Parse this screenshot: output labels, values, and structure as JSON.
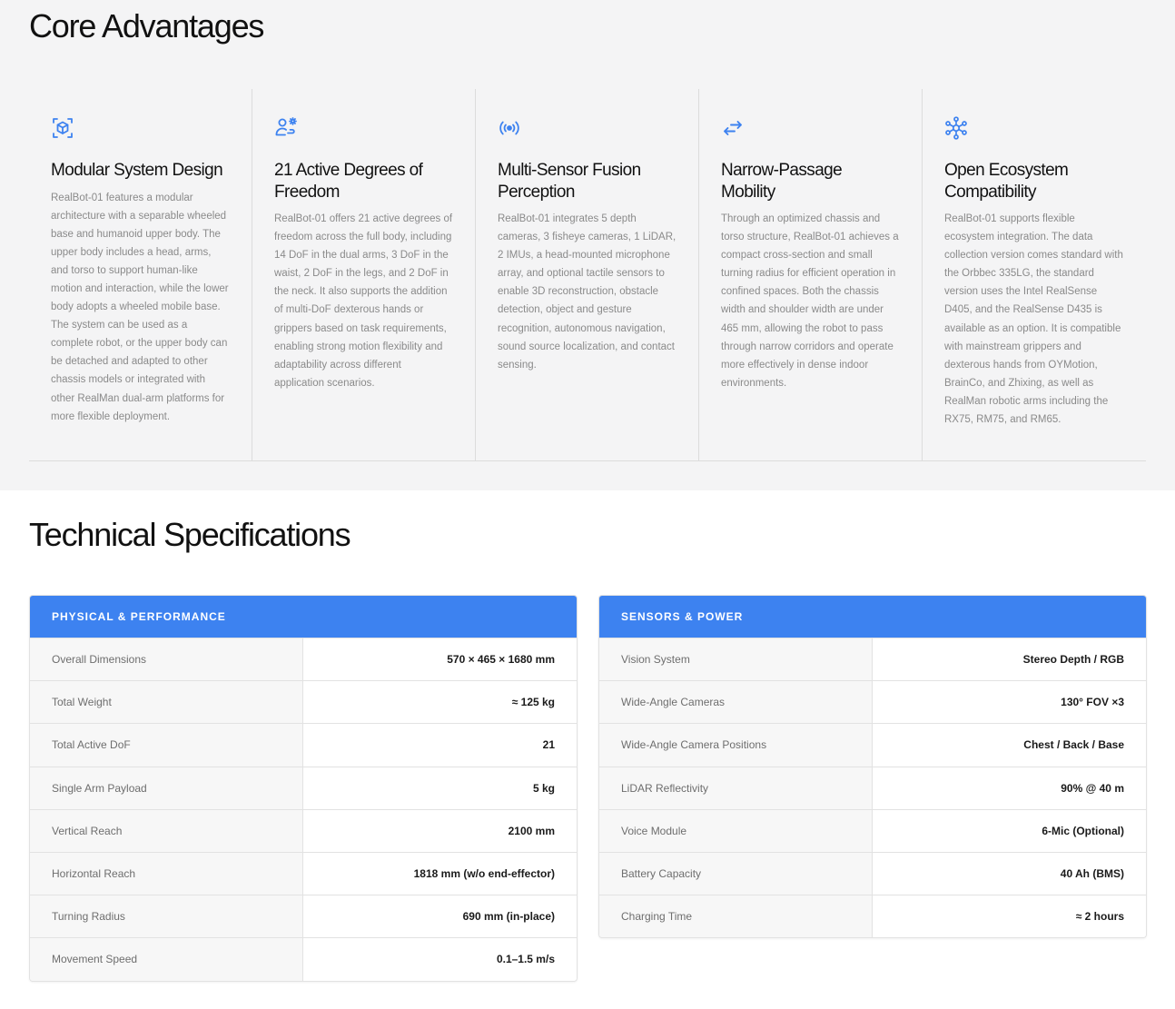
{
  "advantages": {
    "title": "Core Advantages",
    "accent_color": "#3d82f0",
    "cards": [
      {
        "icon": "modular-cube-icon",
        "title": "Modular System Design",
        "desc": "RealBot-01 features a modular architecture with a separable wheeled base and humanoid upper body. The upper body includes a head, arms, and torso to support human-like motion and interaction, while the lower body adopts a wheeled mobile base. The system can be used as a complete robot, or the upper body can be detached and adapted to other chassis models or integrated with other RealMan dual-arm platforms for more flexible deployment."
      },
      {
        "icon": "person-gear-icon",
        "title": "21 Active Degrees of Freedom",
        "desc": "RealBot-01 offers 21 active degrees of freedom across the full body, including 14 DoF in the dual arms, 3 DoF in the waist, 2 DoF in the legs, and 2 DoF in the neck. It also supports the addition of multi-DoF dexterous hands or grippers based on task requirements, enabling strong motion flexibility and adaptability across different application scenarios."
      },
      {
        "icon": "signal-broadcast-icon",
        "title": "Multi-Sensor Fusion Perception",
        "desc": "RealBot-01 integrates 5 depth cameras, 3 fisheye cameras, 1 LiDAR, 2 IMUs, a head-mounted microphone array, and optional tactile sensors to enable 3D reconstruction, obstacle detection, object and gesture recognition, autonomous navigation, sound source localization, and contact sensing."
      },
      {
        "icon": "arrows-left-right-icon",
        "title": "Narrow-Passage Mobility",
        "desc": "Through an optimized chassis and torso structure, RealBot-01 achieves a compact cross-section and small turning radius for efficient operation in confined spaces. Both the chassis width and shoulder width are under 465 mm, allowing the robot to pass through narrow corridors and operate more effectively in dense indoor environments."
      },
      {
        "icon": "network-hub-icon",
        "title": "Open Ecosystem Compatibility",
        "desc": "RealBot-01 supports flexible ecosystem integration. The data collection version comes standard with the Orbbec 335LG, the standard version uses the Intel RealSense D405, and the RealSense D435 is available as an option. It is compatible with mainstream grippers and dexterous hands from OYMotion, BrainCo, and Zhixing, as well as RealMan robotic arms including the RX75, RM75, and RM65."
      }
    ]
  },
  "specs": {
    "title": "Technical Specifications",
    "header_color": "#3d82f0",
    "physical": {
      "header": "PHYSICAL & PERFORMANCE",
      "rows": [
        {
          "label": "Overall Dimensions",
          "value": "570 × 465 × 1680 mm"
        },
        {
          "label": "Total Weight",
          "value": "≈ 125 kg"
        },
        {
          "label": "Total Active DoF",
          "value": "21"
        },
        {
          "label": "Single Arm Payload",
          "value": "5 kg"
        },
        {
          "label": "Vertical Reach",
          "value": "2100 mm"
        },
        {
          "label": "Horizontal Reach",
          "value": "1818 mm (w/o end-effector)"
        },
        {
          "label": "Turning Radius",
          "value": "690 mm (in-place)"
        },
        {
          "label": "Movement Speed",
          "value": "0.1–1.5 m/s"
        }
      ]
    },
    "sensors": {
      "header": "SENSORS & POWER",
      "rows": [
        {
          "label": "Vision System",
          "value": "Stereo Depth / RGB"
        },
        {
          "label": "Wide-Angle Cameras",
          "value": "130° FOV ×3"
        },
        {
          "label": "Wide-Angle Camera Positions",
          "value": "Chest / Back / Base"
        },
        {
          "label": "LiDAR Reflectivity",
          "value": "90% @ 40 m"
        },
        {
          "label": "Voice Module",
          "value": "6-Mic (Optional)"
        },
        {
          "label": "Battery Capacity",
          "value": "40 Ah (BMS)"
        },
        {
          "label": "Charging Time",
          "value": "≈ 2 hours"
        }
      ]
    }
  }
}
